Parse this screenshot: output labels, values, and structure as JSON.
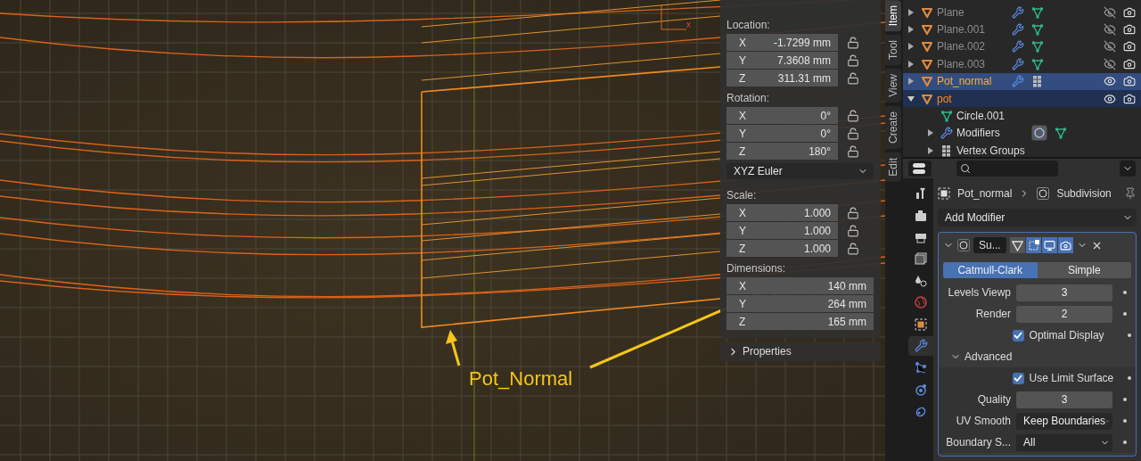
{
  "viewport": {
    "annotation": "Pot_Normal",
    "gizmo_label": "x"
  },
  "transform": {
    "sections": [
      {
        "kind": "vector",
        "label": "Location:",
        "fields": [
          {
            "axis": "X",
            "value": "-1.7299 mm"
          },
          {
            "axis": "Y",
            "value": "7.3608 mm"
          },
          {
            "axis": "Z",
            "value": "311.31 mm"
          }
        ]
      },
      {
        "kind": "vector",
        "label": "Rotation:",
        "fields": [
          {
            "axis": "X",
            "value": "0°"
          },
          {
            "axis": "Y",
            "value": "0°"
          },
          {
            "axis": "Z",
            "value": "180°"
          }
        ]
      },
      {
        "kind": "dropdown",
        "value": "XYZ Euler"
      },
      {
        "kind": "vector",
        "label": "Scale:",
        "fields": [
          {
            "axis": "X",
            "value": "1.000"
          },
          {
            "axis": "Y",
            "value": "1.000"
          },
          {
            "axis": "Z",
            "value": "1.000"
          }
        ]
      },
      {
        "kind": "dimensions",
        "label": "Dimensions:",
        "fields": [
          {
            "axis": "X",
            "value": "140 mm"
          },
          {
            "axis": "Y",
            "value": "264 mm"
          },
          {
            "axis": "Z",
            "value": "165 mm"
          }
        ]
      }
    ],
    "subpanel": {
      "label": "Properties",
      "expanded": false
    }
  },
  "sidebar_tabs": [
    {
      "label": "Item",
      "selected": true
    },
    {
      "label": "Tool",
      "selected": false
    },
    {
      "label": "View",
      "selected": false
    },
    {
      "label": "Create",
      "selected": false
    },
    {
      "label": "Edit",
      "selected": false
    }
  ],
  "outliner": {
    "rows": [
      {
        "name": "Plane",
        "kind": "modified_mesh",
        "selected": false,
        "active": false,
        "expanded": false,
        "visible": false
      },
      {
        "name": "Plane.001",
        "kind": "modified_mesh",
        "selected": false,
        "active": false,
        "expanded": false,
        "visible": false
      },
      {
        "name": "Plane.002",
        "kind": "modified_mesh",
        "selected": false,
        "active": false,
        "expanded": false,
        "visible": false
      },
      {
        "name": "Plane.003",
        "kind": "modified_mesh",
        "selected": false,
        "active": false,
        "expanded": false,
        "visible": false
      },
      {
        "name": "Pot_normal",
        "kind": "modified_groups",
        "selected": true,
        "active": false,
        "expanded": false,
        "visible": true
      },
      {
        "name": "pot",
        "kind": "plain",
        "selected": false,
        "active": true,
        "expanded": true,
        "visible": true,
        "children": [
          {
            "name": "Circle.001",
            "kind": "mesh"
          },
          {
            "name": "Modifiers",
            "kind": "modifiers"
          },
          {
            "name": "Vertex Groups",
            "kind": "groups"
          }
        ]
      }
    ]
  },
  "properties": {
    "tabs": [
      {
        "kind": "tool",
        "selected": false
      },
      {
        "kind": "render",
        "selected": false
      },
      {
        "kind": "output",
        "selected": false
      },
      {
        "kind": "view_layer",
        "selected": false
      },
      {
        "kind": "scene",
        "selected": false
      },
      {
        "kind": "world",
        "selected": false
      },
      {
        "kind": "object",
        "selected": false
      },
      {
        "kind": "modifiers",
        "selected": true
      },
      {
        "kind": "particles",
        "selected": false
      },
      {
        "kind": "physics",
        "selected": false
      },
      {
        "kind": "constraints",
        "selected": false
      }
    ],
    "breadcrumb": [
      "Pot_normal",
      "Subdivision"
    ],
    "add_modifier": "Add Modifier",
    "modifier": {
      "name": "Su...",
      "expanded": true,
      "toggles": [
        {
          "kind": "on_cage",
          "on": false
        },
        {
          "kind": "edit_mode",
          "on": true
        },
        {
          "kind": "viewport",
          "on": true
        },
        {
          "kind": "render",
          "on": true
        }
      ],
      "types": [
        {
          "label": "Catmull-Clark",
          "selected": true
        },
        {
          "label": "Simple",
          "selected": false
        }
      ],
      "rows": [
        {
          "kind": "number",
          "label": "Levels Viewp",
          "value": "3"
        },
        {
          "kind": "number",
          "label": "Render",
          "value": "2"
        },
        {
          "kind": "checkbox",
          "label": "Optimal Display",
          "checked": true
        },
        {
          "kind": "subpanel",
          "label": "Advanced",
          "expanded": true
        },
        {
          "kind": "checkbox",
          "label": "Use Limit Surface",
          "checked": true
        },
        {
          "kind": "number",
          "label": "Quality",
          "value": "3"
        },
        {
          "kind": "dropdown",
          "label": "UV Smooth",
          "value": "Keep Boundaries"
        },
        {
          "kind": "dropdown",
          "label": "Boundary S...",
          "value": "All"
        }
      ]
    }
  }
}
